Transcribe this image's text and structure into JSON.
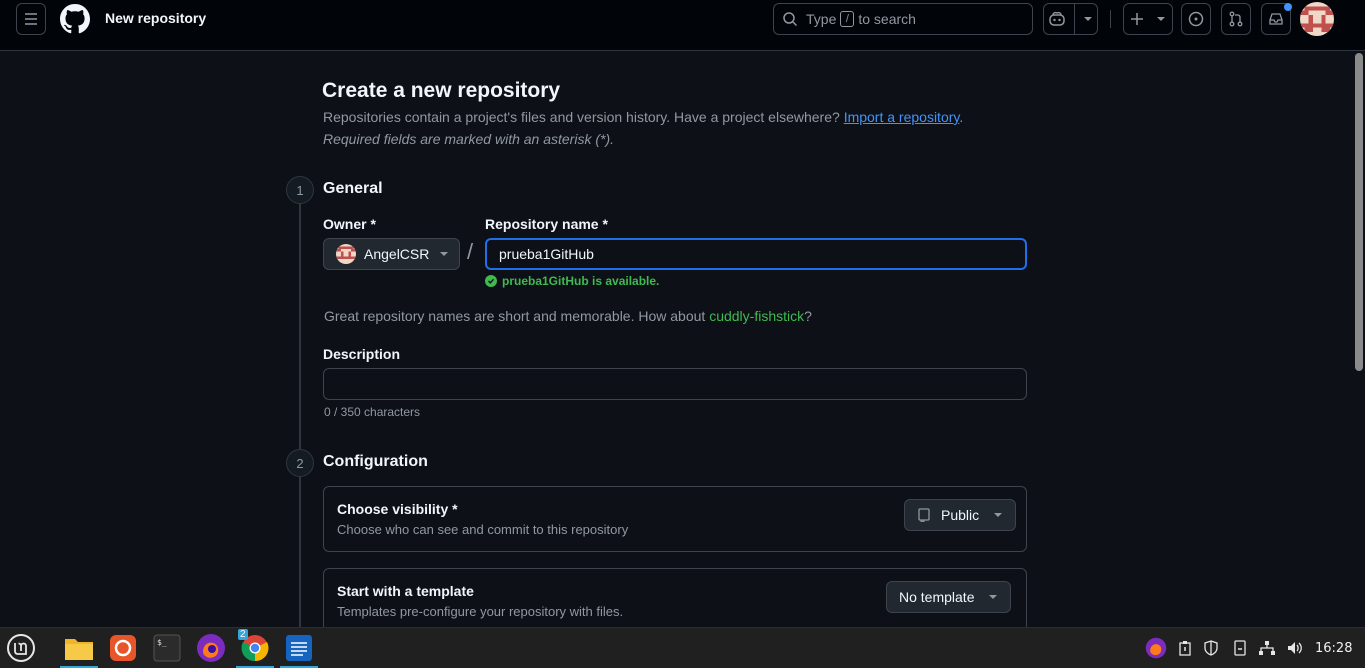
{
  "header": {
    "page_context": "New repository",
    "search_placeholder_prefix": "Type",
    "search_slash": "/",
    "search_placeholder_suffix": "to search"
  },
  "page": {
    "title": "Create a new repository",
    "subtitle": "Repositories contain a project's files and version history. Have a project elsewhere?",
    "import_link": "Import a repository",
    "subtitle_end": ".",
    "required_note": "Required fields are marked with an asterisk (*)."
  },
  "general": {
    "step_number": "1",
    "step_title": "General",
    "owner_label": "Owner *",
    "owner_value": "AngelCSR",
    "separator": "/",
    "repo_name_label": "Repository name *",
    "repo_name_value": "prueba1GitHub",
    "availability": "prueba1GitHub is available.",
    "suggestion_prefix": "Great repository names are short and memorable. How about",
    "suggestion_name": "cuddly-fishstick",
    "suggestion_suffix": "?",
    "description_label": "Description",
    "description_value": "",
    "char_count": "0 / 350 characters"
  },
  "configuration": {
    "step_number": "2",
    "step_title": "Configuration",
    "visibility_title": "Choose visibility *",
    "visibility_sub": "Choose who can see and commit to this repository",
    "visibility_value": "Public",
    "template_title": "Start with a template",
    "template_sub": "Templates pre-configure your repository with files.",
    "template_value": "No template"
  },
  "taskbar": {
    "chrome_badge": "2",
    "clock": "16:28"
  },
  "colors": {
    "accent_blue": "#1f6feb",
    "link_blue": "#4493f8",
    "success_green": "#3fb950",
    "background": "#0d1117"
  }
}
